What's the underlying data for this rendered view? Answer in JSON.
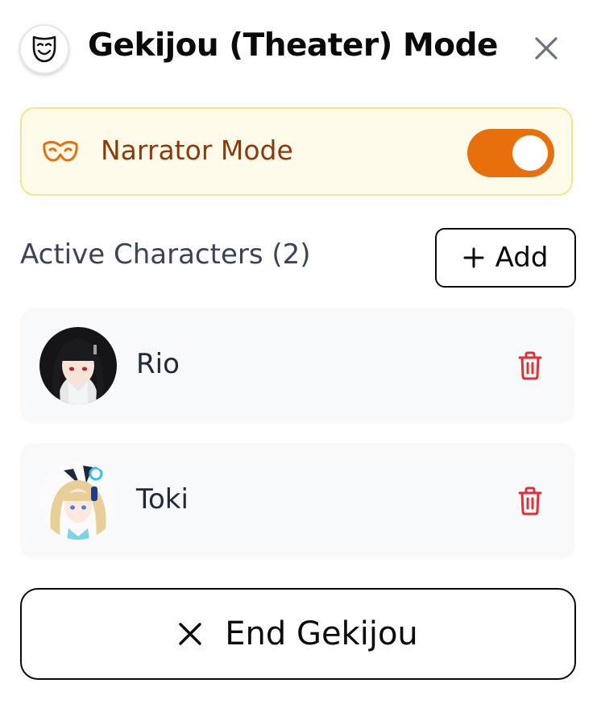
{
  "header": {
    "title": "Gekijou (Theater) Mode",
    "logo_icon": "theater-mask-icon",
    "close_icon": "close-icon"
  },
  "narrator": {
    "label": "Narrator Mode",
    "icon": "domino-mask-icon",
    "enabled": true,
    "accent_color": "#e8700c"
  },
  "characters_section": {
    "title": "Active Characters (2)",
    "add_label": "Add",
    "add_icon": "plus-icon"
  },
  "characters": [
    {
      "name": "Rio",
      "avatar": "rio-avatar",
      "delete_icon": "trash-icon"
    },
    {
      "name": "Toki",
      "avatar": "toki-avatar",
      "delete_icon": "trash-icon"
    }
  ],
  "footer": {
    "end_label": "End Gekijou",
    "end_icon": "close-icon"
  },
  "colors": {
    "delete": "#e0303a",
    "narrator_text": "#8a3a0b",
    "narrator_bg": "#fefbea",
    "narrator_border": "#f6e58e"
  }
}
